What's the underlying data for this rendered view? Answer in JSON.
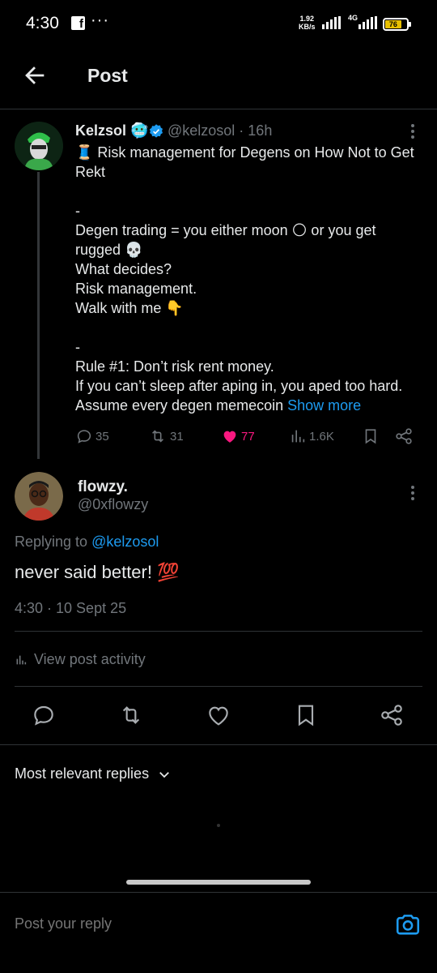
{
  "status_bar": {
    "time": "4:30",
    "dots": "···",
    "speed_value": "1.92",
    "speed_unit": "KB/s",
    "network": "4G",
    "battery_level": "76",
    "battery_color": "#e8c000"
  },
  "header": {
    "title": "Post",
    "back_icon": "arrow-left-icon"
  },
  "parent_post": {
    "author_name": "Kelzsol",
    "handle_time": "@kelzosol · 16h",
    "lines": [
      "🧵 Risk management for Degens on How Not to Get Rekt",
      "",
      "-",
      "Degen trading = you either moon 🌕 or you get rugged 💀",
      "What decides?",
      "Risk management.",
      "Walk with me 👇",
      "",
      "-",
      "Rule #1: Don’t risk rent money.",
      "If you can’t sleep after aping in, you aped too hard."
    ],
    "last_line": "Assume every degen memecoin",
    "show_more": "Show more",
    "replies": "35",
    "reposts": "31",
    "likes": "77",
    "views": "1.6K"
  },
  "reply_post": {
    "author_name": "flowzy.",
    "handle": "@0xflowzy",
    "replying_prefix": "Replying to",
    "replying_handle": "@kelzosol",
    "text": "never said better! 💯",
    "timestamp": "4:30 · 10 Sept 25",
    "view_activity": "View post activity"
  },
  "replies_sort": {
    "label": "Most relevant replies"
  },
  "composer": {
    "placeholder": "Post your reply"
  },
  "colors": {
    "background": "#000000",
    "accent": "#1d9bf0",
    "like": "#f91880",
    "muted": "#71767b",
    "divider": "#2f3336"
  }
}
